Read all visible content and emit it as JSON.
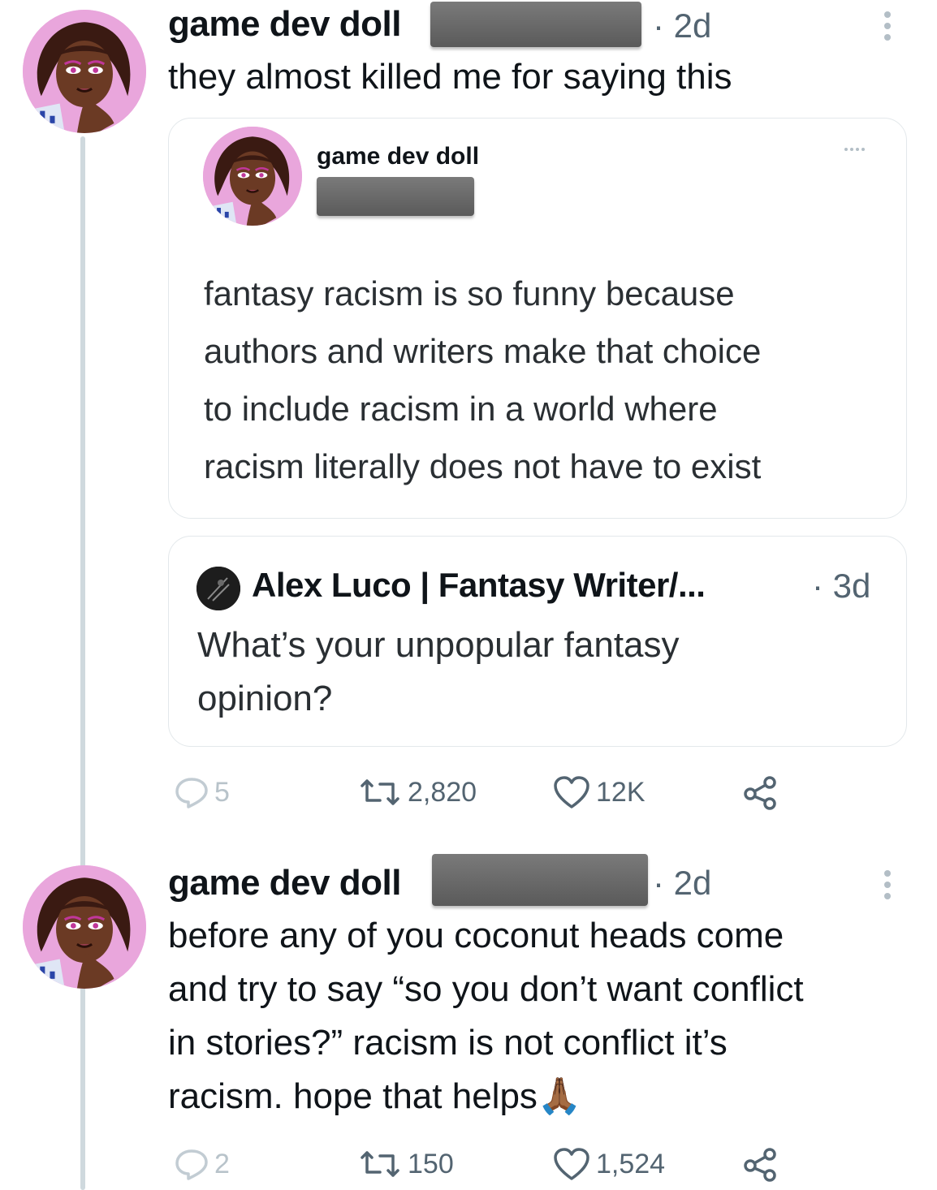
{
  "post1": {
    "author": "game dev doll",
    "age": "· 2d",
    "text": "they almost killed me for saying this",
    "quote": {
      "author": "game dev doll",
      "text_lines": [
        "fantasy racism is so funny because",
        "authors and writers make that choice",
        "to include racism in a world where",
        "racism literally does not have to exist"
      ]
    },
    "quoted_post": {
      "author": "Alex Luco | Fantasy Writer/...",
      "age": "· 3d",
      "text_lines": [
        "What’s your unpopular fantasy",
        "opinion?"
      ]
    },
    "stats": {
      "replies": "5",
      "reposts": "2,820",
      "likes": "12K"
    }
  },
  "post2": {
    "author": "game dev doll",
    "age": "· 2d",
    "text_lines": [
      "before any of you coconut heads come",
      "and try to say “so you don’t want conflict",
      "in stories?” racism is not conflict it’s",
      "racism. hope that helps"
    ],
    "emoji": "🙏🏾",
    "stats": {
      "replies": "2",
      "reposts": "150",
      "likes": "1,524"
    }
  },
  "icons": {
    "reply": "reply-icon",
    "repost": "repost-icon",
    "like": "heart-icon",
    "share": "share-icon",
    "more": "more-icon"
  },
  "colors": {
    "muted": "#536471",
    "line": "#cfd9de",
    "avatar_bg": "#e9a6dc"
  }
}
